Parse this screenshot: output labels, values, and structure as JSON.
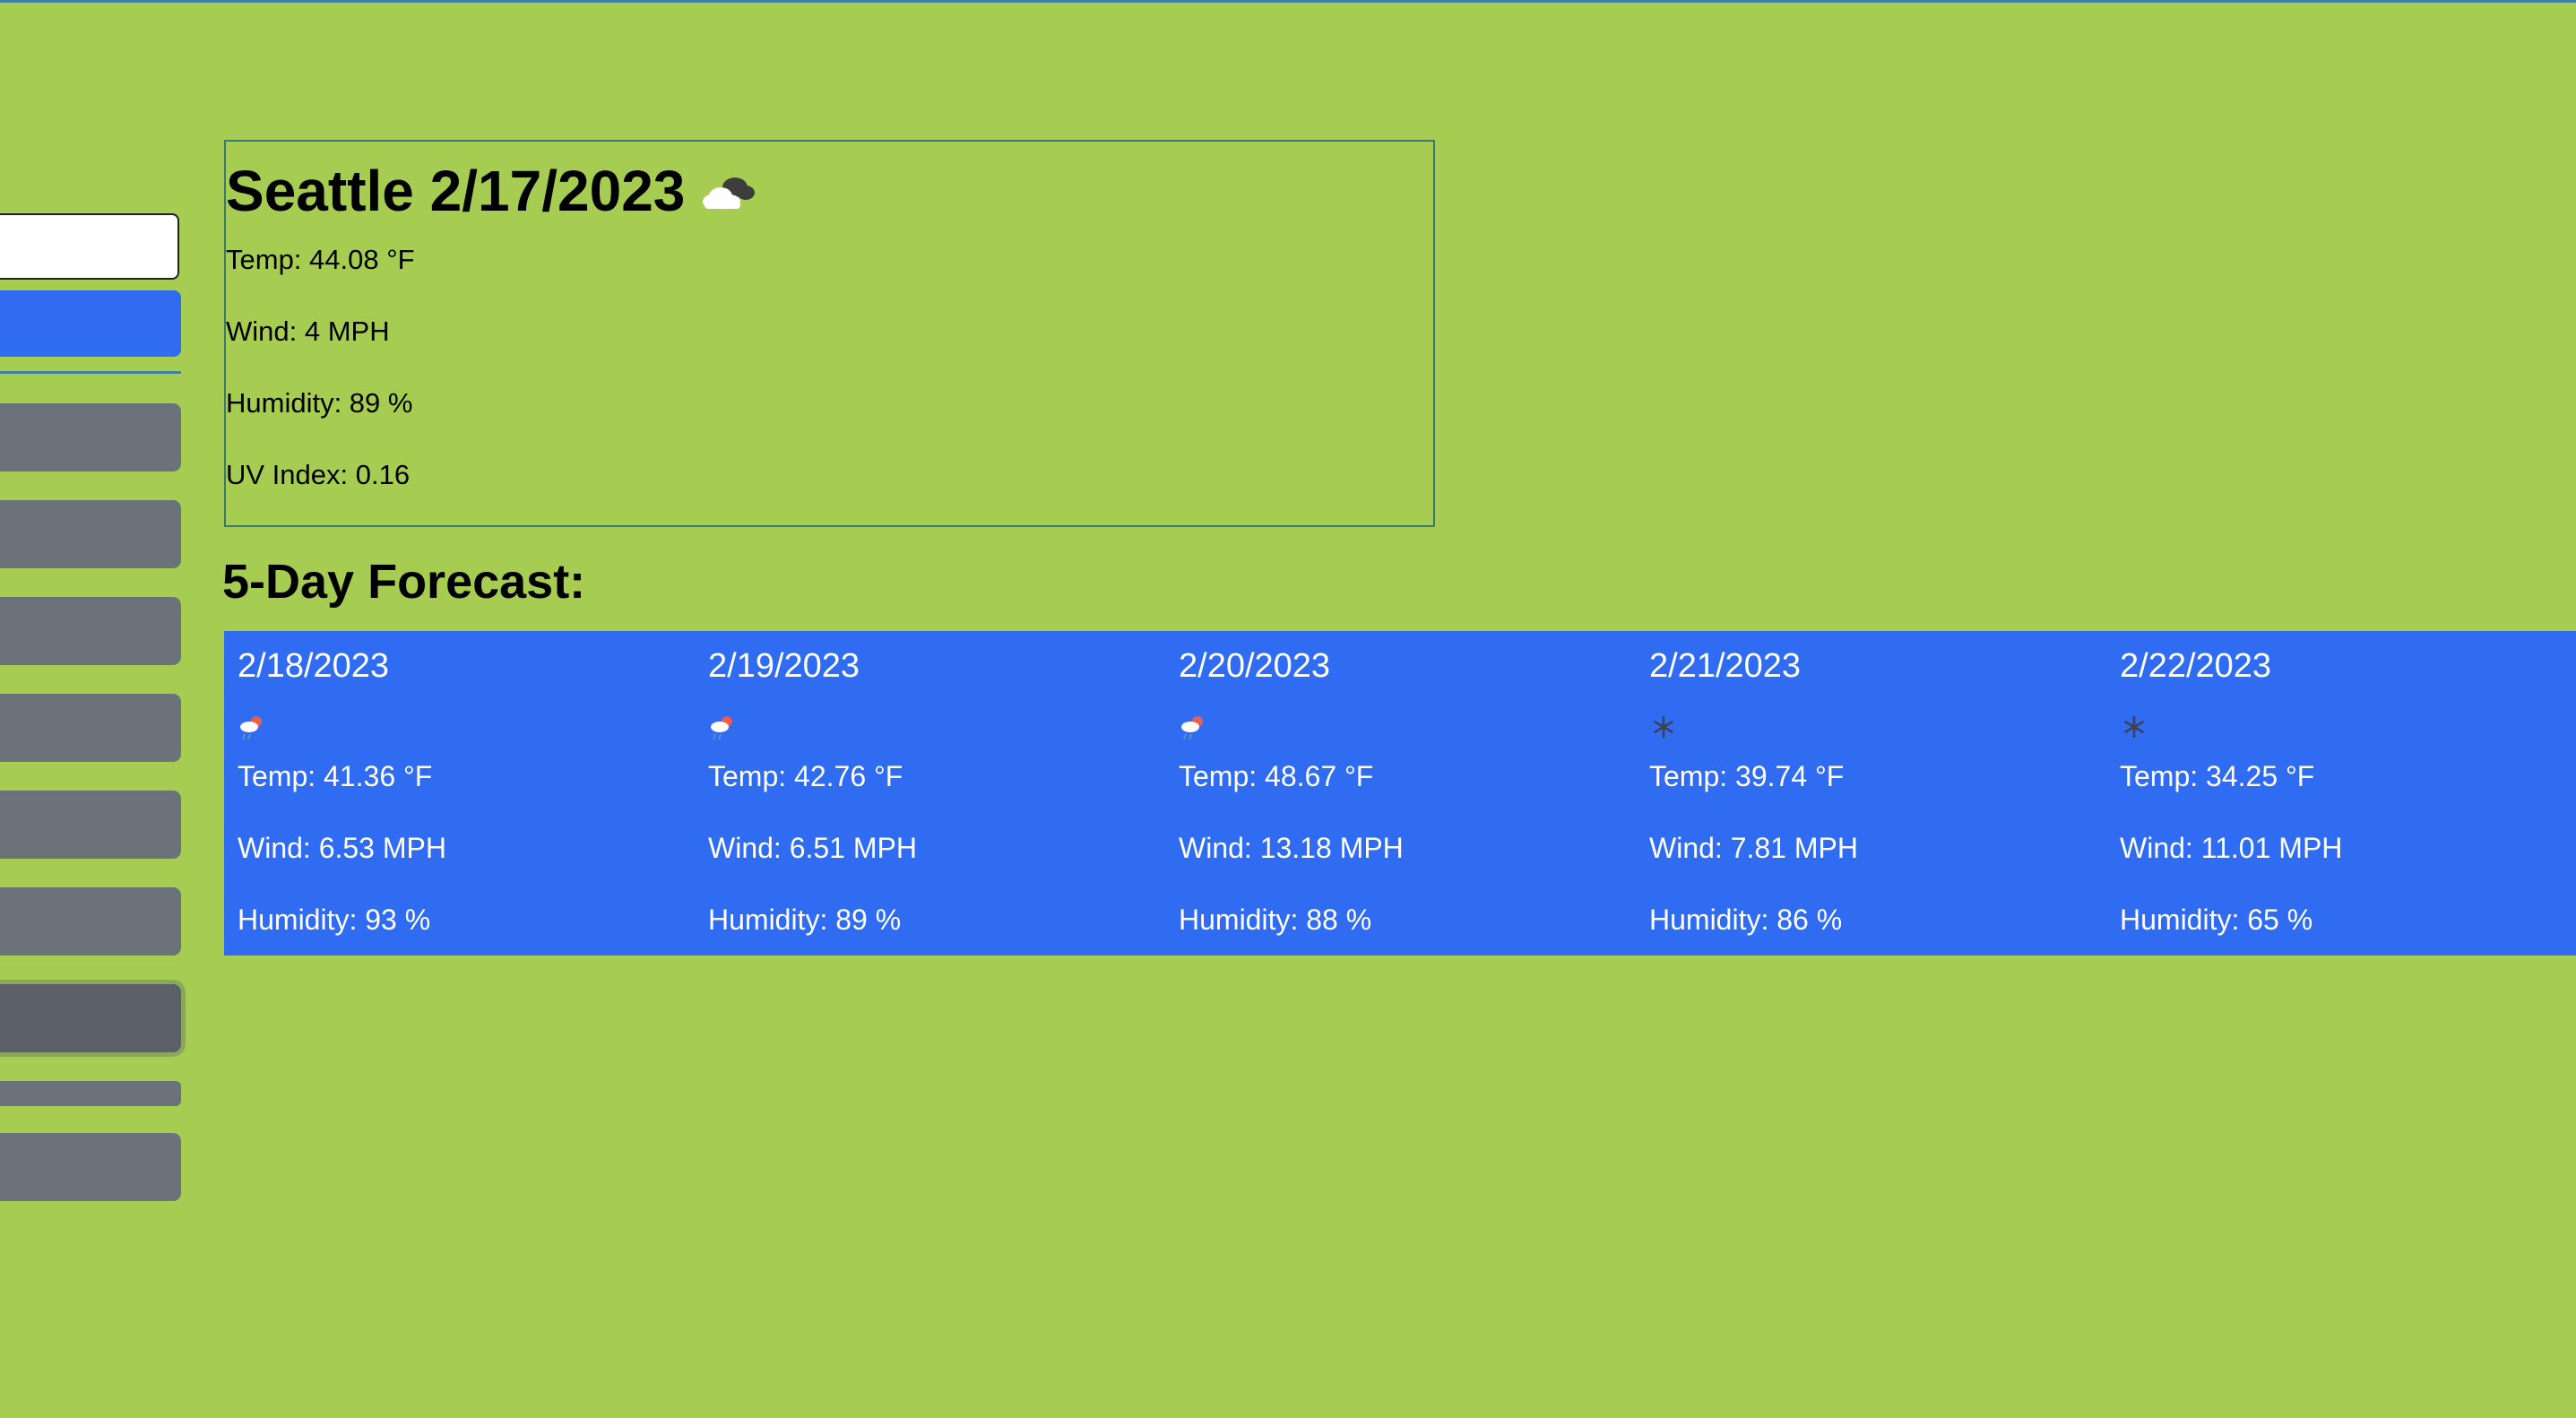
{
  "search": {
    "input_value": "",
    "button_label": ""
  },
  "history": {
    "items": [
      "",
      "",
      "",
      "",
      "",
      "",
      "",
      "",
      ""
    ]
  },
  "current": {
    "city_date": "Seattle 2/17/2023",
    "icon": "broken-clouds-icon",
    "temp": "Temp: 44.08 °F",
    "wind": "Wind: 4 MPH",
    "humidity": "Humidity: 89 %",
    "uv": "UV Index: 0.16"
  },
  "forecast": {
    "heading": "5-Day Forecast:",
    "days": [
      {
        "date": "2/18/2023",
        "icon": "rain-snow-icon",
        "temp": "Temp: 41.36 °F",
        "wind": "Wind: 6.53 MPH",
        "humidity": "Humidity: 93 %"
      },
      {
        "date": "2/19/2023",
        "icon": "rain-snow-icon",
        "temp": "Temp: 42.76 °F",
        "wind": "Wind: 6.51 MPH",
        "humidity": "Humidity: 89 %"
      },
      {
        "date": "2/20/2023",
        "icon": "rain-snow-icon",
        "temp": "Temp: 48.67 °F",
        "wind": "Wind: 13.18 MPH",
        "humidity": "Humidity: 88 %"
      },
      {
        "date": "2/21/2023",
        "icon": "snowflake-icon",
        "temp": "Temp: 39.74 °F",
        "wind": "Wind: 7.81 MPH",
        "humidity": "Humidity: 86 %"
      },
      {
        "date": "2/22/2023",
        "icon": "snowflake-icon",
        "temp": "Temp: 34.25 °F",
        "wind": "Wind: 11.01 MPH",
        "humidity": "Humidity: 65 %"
      }
    ]
  },
  "colors": {
    "page_background": "#a6cd51",
    "accent_blue": "#306cf1",
    "history_button": "#6c727a",
    "history_button_active": "#5b6068"
  }
}
